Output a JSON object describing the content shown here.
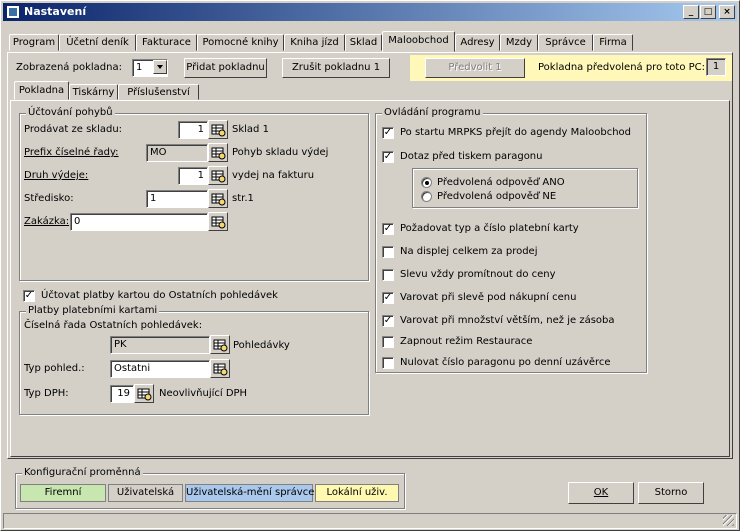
{
  "window": {
    "title": "Nastavení",
    "min_glyph": "_",
    "max_glyph": "□",
    "close_glyph": "×"
  },
  "tabs": [
    {
      "label": "Program"
    },
    {
      "label": "Účetní deník"
    },
    {
      "label": "Fakturace"
    },
    {
      "label": "Pomocné knihy"
    },
    {
      "label": "Kniha jízd"
    },
    {
      "label": "Sklad"
    },
    {
      "label": "Maloobchod",
      "active": true
    },
    {
      "label": "Adresy"
    },
    {
      "label": "Mzdy"
    },
    {
      "label": "Správce"
    },
    {
      "label": "Firma"
    }
  ],
  "header": {
    "pokladna_label": "Zobrazená pokladna:",
    "pokladna_value": "1",
    "add_button": "Přidat pokladnu",
    "cancel_button": "Zrušit pokladnu 1",
    "preselect_button": "Předvolit 1",
    "preselected_label": "Pokladna předvolená pro toto PC:",
    "preselected_value": "1"
  },
  "subtabs": [
    {
      "label": "Pokladna",
      "active": true
    },
    {
      "label": "Tiskárny"
    },
    {
      "label": "Příslušenství"
    }
  ],
  "ucetni_pohyby": {
    "legend": "Účtování pohybů",
    "prodavat_label": "Prodávat ze skladu:",
    "prodavat_value": "1",
    "prodavat_desc": "Sklad 1",
    "prefix_label": "Prefix číselné řady:",
    "prefix_value": "MO",
    "prefix_desc": "Pohyb skladu výdej",
    "druh_label": "Druh výdeje:",
    "druh_value": "1",
    "druh_desc": "vydej na fakturu",
    "stredisko_label": "Středisko:",
    "stredisko_value": "1",
    "stredisko_desc": "str.1",
    "zakazka_label": "Zakázka:",
    "zakazka_value": "0"
  },
  "ucetnovat_karty": {
    "label": "Účtovat platby kartou do Ostatních pohledávek",
    "checked": true
  },
  "platby_kartami": {
    "legend": "Platby platebními kartami",
    "ciselna_rada_label": "Číselná řada Ostatních pohledávek:",
    "rada_value": "PK",
    "rada_desc": "Pohledávky",
    "typ_pohled_label": "Typ pohled.:",
    "typ_pohled_value": "Ostatni",
    "typ_dph_label": "Typ DPH:",
    "typ_dph_value": "19",
    "typ_dph_desc": "Neovlivňující DPH"
  },
  "ovladani": {
    "legend": "Ovládání programu",
    "items": [
      {
        "label": "Po startu MRPKS přejít do agendy Maloobchod",
        "checked": true
      },
      {
        "label": "Dotaz před tiskem paragonu",
        "checked": true
      },
      {
        "label": "Požadovat typ a číslo platební karty",
        "checked": true
      },
      {
        "label": "Na displej celkem za prodej",
        "checked": false
      },
      {
        "label": "Slevu vždy promítnout do ceny",
        "checked": false
      },
      {
        "label": "Varovat při slevě pod nákupní cenu",
        "checked": true
      },
      {
        "label": "Varovat při množství větším, než je zásoba",
        "checked": true
      },
      {
        "label": "Zapnout režim Restaurace",
        "checked": false
      },
      {
        "label": "Nulovat číslo paragonu po denní uzávěrce",
        "checked": false
      }
    ],
    "radio_yes": "Předvolená odpověď ANO",
    "radio_no": "Předvolená odpověď NE"
  },
  "konfigurace": {
    "legend": "Konfigurační proměnná",
    "firemni": "Firemní",
    "uzivatelska": "Uživatelská",
    "uziv_spravce": "Uživatelská-mění správce",
    "lokalni": "Lokální uživ.",
    "colors": {
      "firemni": "#c8e6b0",
      "uzivatelska": "#d4d0c8",
      "uziv_spravce": "#a9c8ec",
      "lokalni": "#fff8b0"
    }
  },
  "footer": {
    "ok": "OK",
    "storno": "Storno"
  },
  "icons": {
    "picker": "lookup-table-icon",
    "app": "window-app-icon"
  }
}
